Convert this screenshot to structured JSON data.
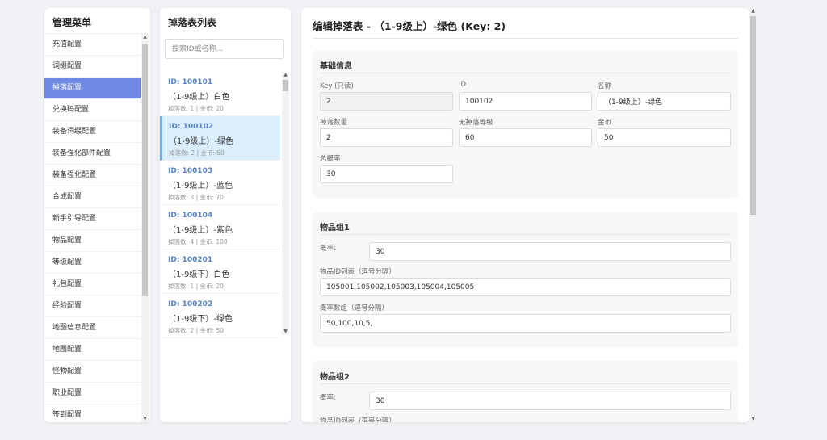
{
  "menu": {
    "title": "管理菜单",
    "items": [
      {
        "label": "充值配置"
      },
      {
        "label": "词缀配置"
      },
      {
        "label": "掉落配置"
      },
      {
        "label": "兑换码配置"
      },
      {
        "label": "装备词缀配置"
      },
      {
        "label": "装备强化部件配置"
      },
      {
        "label": "装备强化配置"
      },
      {
        "label": "合成配置"
      },
      {
        "label": "新手引导配置"
      },
      {
        "label": "物品配置"
      },
      {
        "label": "等级配置"
      },
      {
        "label": "礼包配置"
      },
      {
        "label": "经验配置"
      },
      {
        "label": "地图信息配置"
      },
      {
        "label": "地图配置"
      },
      {
        "label": "怪物配置"
      },
      {
        "label": "职业配置"
      },
      {
        "label": "签到配置"
      }
    ],
    "active_index": 2
  },
  "list": {
    "title": "掉落表列表",
    "search_placeholder": "搜索ID或名称...",
    "items": [
      {
        "id": "ID: 100101",
        "name": "（1-9级上）白色",
        "meta": "掉落数: 1 | 金币: 20"
      },
      {
        "id": "ID: 100102",
        "name": "（1-9级上）-绿色",
        "meta": "掉落数: 2 | 金币: 50"
      },
      {
        "id": "ID: 100103",
        "name": "（1-9级上）-蓝色",
        "meta": "掉落数: 3 | 金币: 70"
      },
      {
        "id": "ID: 100104",
        "name": "（1-9级上）-紫色",
        "meta": "掉落数: 4 | 金币: 100"
      },
      {
        "id": "ID: 100201",
        "name": "（1-9级下）白色",
        "meta": "掉落数: 1 | 金币: 20"
      },
      {
        "id": "ID: 100202",
        "name": "（1-9级下）-绿色",
        "meta": "掉落数: 2 | 金币: 50"
      }
    ],
    "active_index": 1
  },
  "editor": {
    "title": "编辑掉落表 - （1-9级上）-绿色 (Key: 2)",
    "basic": {
      "title": "基础信息",
      "key_label": "Key (只读)",
      "key_value": "2",
      "id_label": "ID",
      "id_value": "100102",
      "name_label": "名称",
      "name_value": "（1-9级上）-绿色",
      "count_label": "掉落数量",
      "count_value": "2",
      "nodrop_label": "无掉落等级",
      "nodrop_value": "60",
      "gold_label": "金币",
      "gold_value": "50",
      "total_label": "总概率",
      "total_value": "30"
    },
    "group1": {
      "title": "物品组1",
      "rate_label": "概率:",
      "rate_value": "30",
      "ids_label": "物品ID列表（逗号分隔）",
      "ids_value": "105001,105002,105003,105004,105005",
      "rates_label": "概率数组（逗号分隔）",
      "rates_value": "50,100,10,5,"
    },
    "group2": {
      "title": "物品组2",
      "rate_label": "概率:",
      "rate_value": "30",
      "ids_label": "物品ID列表（逗号分隔）"
    }
  },
  "colors": {
    "accent": "#6f89e3",
    "selected_item_bg": "#dbeefc",
    "id_link": "#5a84c8"
  },
  "icons": {
    "scroll_up": "▲",
    "scroll_down": "▼"
  }
}
